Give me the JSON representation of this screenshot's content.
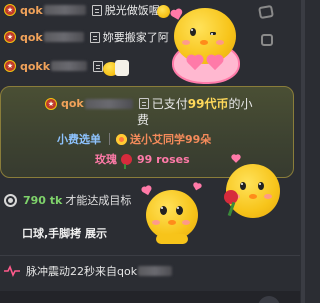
{
  "messages": [
    {
      "user": "qok",
      "text": "脱光做饭喔",
      "badge_icon": "star-badge"
    },
    {
      "user": "qok",
      "text": "妳要搬家了阿",
      "badge_icon": "star-badge"
    },
    {
      "user": "qokk",
      "text": "",
      "badge_icon": "star-badge"
    }
  ],
  "gift": {
    "user": "qok",
    "paid_prefix": "已支付",
    "amount": "99代币",
    "paid_suffix": "的小",
    "paid_suffix2": "费",
    "menu_label": "小费选单",
    "send_text": "送小艾同学99朵",
    "rose_label": "玫瑰",
    "rose_count": "99 roses"
  },
  "target": {
    "tk_count": "790 tk",
    "text": "才能达成目标"
  },
  "show": "口球,手脚拷 展示",
  "pulse": {
    "text_pre": "脉冲震动22秒来自",
    "user": "qok"
  },
  "colors": {
    "username": "#f0a25a",
    "gold": "#ffd95a",
    "menu": "#8ec3ff",
    "tk": "#7fd36b",
    "rose_text": "#ff7aa8"
  }
}
